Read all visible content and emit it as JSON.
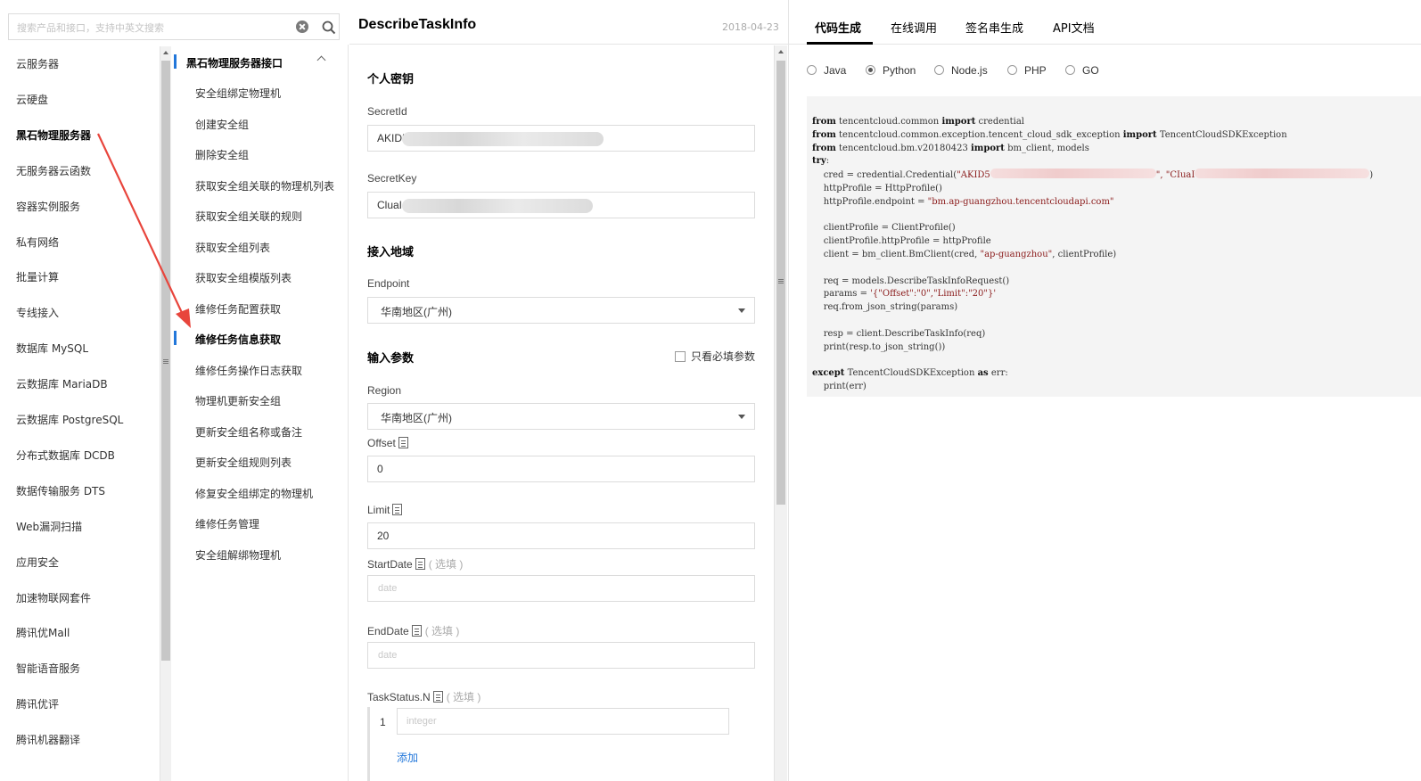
{
  "search": {
    "placeholder": "搜索产品和接口，支持中英文搜索"
  },
  "products": [
    {
      "label": "云服务器"
    },
    {
      "label": "云硬盘"
    },
    {
      "label": "黑石物理服务器",
      "active": true
    },
    {
      "label": "无服务器云函数"
    },
    {
      "label": "容器实例服务"
    },
    {
      "label": "私有网络"
    },
    {
      "label": "批量计算"
    },
    {
      "label": "专线接入"
    },
    {
      "label": "数据库 MySQL"
    },
    {
      "label": "云数据库 MariaDB"
    },
    {
      "label": "云数据库 PostgreSQL"
    },
    {
      "label": "分布式数据库 DCDB"
    },
    {
      "label": "数据传输服务 DTS"
    },
    {
      "label": "Web漏洞扫描"
    },
    {
      "label": "应用安全"
    },
    {
      "label": "加速物联网套件"
    },
    {
      "label": "腾讯优Mall"
    },
    {
      "label": "智能语音服务"
    },
    {
      "label": "腾讯优评"
    },
    {
      "label": "腾讯机器翻译"
    }
  ],
  "api_group": {
    "label": "黑石物理服务器接口"
  },
  "apis": [
    {
      "label": "安全组绑定物理机"
    },
    {
      "label": "创建安全组"
    },
    {
      "label": "删除安全组"
    },
    {
      "label": "获取安全组关联的物理机列表"
    },
    {
      "label": "获取安全组关联的规则"
    },
    {
      "label": "获取安全组列表"
    },
    {
      "label": "获取安全组模版列表"
    },
    {
      "label": "维修任务配置获取"
    },
    {
      "label": "维修任务信息获取",
      "active": true
    },
    {
      "label": "维修任务操作日志获取"
    },
    {
      "label": "物理机更新安全组"
    },
    {
      "label": "更新安全组名称或备注"
    },
    {
      "label": "更新安全组规则列表"
    },
    {
      "label": "修复安全组绑定的物理机"
    },
    {
      "label": "维修任务管理"
    },
    {
      "label": "安全组解绑物理机"
    }
  ],
  "form": {
    "title": "DescribeTaskInfo",
    "date": "2018-04-23",
    "secret_section": "个人密钥",
    "secret_id_label": "SecretId",
    "secret_id_value": "AKID5",
    "secret_key_label": "SecretKey",
    "secret_key_value": "CluaI",
    "region_section": "接入地域",
    "endpoint_label": "Endpoint",
    "endpoint_value": "华南地区(广州)",
    "params_section": "输入参数",
    "required_only": "只看必填参数",
    "region_label": "Region",
    "region_value": "华南地区(广州)",
    "offset_label": "Offset",
    "offset_value": "0",
    "limit_label": "Limit",
    "limit_value": "20",
    "startdate_label": "StartDate",
    "enddate_label": "EndDate",
    "taskstatus_label": "TaskStatus.N",
    "optional": "( 选填 )",
    "date_placeholder": "date",
    "integer_placeholder": "integer",
    "array_index": "1",
    "add_label": "添加"
  },
  "tabs": [
    {
      "label": "代码生成",
      "active": true
    },
    {
      "label": "在线调用"
    },
    {
      "label": "签名串生成"
    },
    {
      "label": "API文档"
    }
  ],
  "languages": [
    {
      "label": "Java"
    },
    {
      "label": "Python",
      "selected": true
    },
    {
      "label": "Node.js"
    },
    {
      "label": "PHP"
    },
    {
      "label": "GO"
    }
  ],
  "code": {
    "l1_rest": " tencentcloud.common ",
    "l1_rest2": " credential",
    "l2_rest": " tencentcloud.common.exception.tencent_cloud_sdk_exception ",
    "l2_rest2": " TencentCloudSDKException",
    "l3_rest": " tencentcloud.bm.v20180423 ",
    "l3_rest2": " bm_client, models",
    "cred_pre": "    cred = credential.Credential(",
    "cred_id": "\"AKID5",
    "cred_mid": "\", \"CIuaI",
    "cred_end": ")",
    "line_http1": "    httpProfile = HttpProfile()",
    "line_http2": "    httpProfile.endpoint = ",
    "endpoint_str": "\"bm.ap-guangzhou.tencentcloudapi.com\"",
    "line_cp1": "    clientProfile = ClientProfile()",
    "line_cp2": "    clientProfile.httpProfile = httpProfile",
    "line_client_pre": "    client = bm_client.BmClient(cred, ",
    "region_str": "\"ap-guangzhou\"",
    "line_client_post": ", clientProfile)",
    "line_req1": "    req = models.DescribeTaskInfoRequest()",
    "line_params_pre": "    params = ",
    "params_str": "'{\"Offset\":\"0\",\"Limit\":\"20\"}'",
    "line_req2": "    req.from_json_string(params)",
    "line_resp1": "    resp = client.DescribeTaskInfo(req)",
    "line_resp2": "    print(resp.to_json_string())",
    "except_rest": " TencentCloudSDKException ",
    "except_rest2": " err:",
    "line_print_err": "    print(err)",
    "kw_from": "from",
    "kw_import": "import",
    "kw_try": "try",
    "kw_except": "except",
    "kw_as": "as",
    "colon": ":"
  },
  "colors": {
    "accent": "#2277da",
    "annotation": "#e8453c"
  }
}
